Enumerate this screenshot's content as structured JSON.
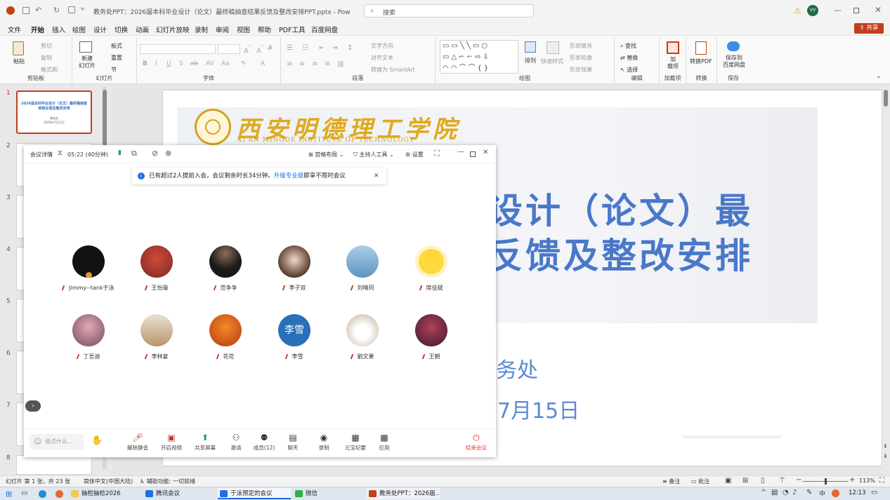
{
  "window": {
    "title": "教务处PPT：2026届本科毕业设计（论文）最终稿抽查结果反馈及整改安排PPT.pptx  -  PowerPoint",
    "search_placeholder": "搜索",
    "user_initials": "YY",
    "share_label": "共享"
  },
  "menu": [
    "文件",
    "开始",
    "插入",
    "绘图",
    "设计",
    "切换",
    "动画",
    "幻灯片放映",
    "录制",
    "审阅",
    "视图",
    "帮助",
    "PDF工具",
    "百度网盘"
  ],
  "ribbon": {
    "clipboard": {
      "paste": "粘贴",
      "cut": "剪切",
      "copy": "复制",
      "format_painter": "格式刷",
      "label": "剪贴板"
    },
    "slides": {
      "new_slide": "新建\n幻灯片",
      "layout": "板式",
      "reset": "重置",
      "section": "节",
      "label": "幻灯片"
    },
    "font": {
      "label": "字体"
    },
    "paragraph": {
      "text_direction": "文字方向",
      "align_text": "对齐文本",
      "convert_smartart": "转换为 SmartArt",
      "label": "段落"
    },
    "drawing": {
      "arrange": "排列",
      "quick_styles": "快速样式",
      "shape_fill": "形状填充",
      "shape_outline": "形状轮廓",
      "shape_effects": "形状效果",
      "label": "绘图"
    },
    "editing": {
      "find": "查找",
      "replace": "替换",
      "select": "选择",
      "label": "编辑"
    },
    "addins": {
      "add": "加\n载项",
      "label": "加载项"
    },
    "convert": {
      "to_pdf": "转换PDF",
      "label": "转换"
    },
    "save": {
      "save_baidu": "保存到\n百度网盘",
      "label": "保存"
    }
  },
  "thumbnails": {
    "numbers": [
      "1",
      "2",
      "3",
      "4",
      "5",
      "6",
      "7",
      "8"
    ],
    "slide1_title": "2026届本科毕业设计（论文）最终稿抽查结果反馈及整改安排",
    "slide1_sub": "教务处",
    "slide1_date": "2026年7月15日"
  },
  "slide": {
    "logo_cn": "西安明德理工学院",
    "logo_en": "XI'AN MINGDE INSTITUTE OF TECHNOLOGY",
    "title_line1": "设计（论文）最",
    "title_line2": "反馈及整改安排",
    "dept": "务处",
    "date": "7月15日"
  },
  "meeting": {
    "details": "会议详情",
    "timer": "05:22 (40分钟)",
    "layout": "宫格布局",
    "host_tools": "主持人工具",
    "settings": "设置",
    "notice": "已有超过2人提前入会，会议剩余时长34分钟。",
    "notice_link": "升级专业版",
    "notice_tail": "即享不限时会议",
    "participants": [
      {
        "name": "Jimmy--tank于泳",
        "color": "#111111",
        "ring": "#d9a03a"
      },
      {
        "name": "王怡璇",
        "color": "#c0392b"
      },
      {
        "name": "范争争",
        "color": "#1d1d1d"
      },
      {
        "name": "李子双",
        "color": "#e3c9b6"
      },
      {
        "name": "刘晴珂",
        "color": "#8fb8d8"
      },
      {
        "name": "席佳斌",
        "color": "#f5c518"
      },
      {
        "name": "丁吾迪",
        "color": "#9b6b7a"
      },
      {
        "name": "李林宴",
        "color": "#b59a76"
      },
      {
        "name": "花花",
        "color": "#e06a1e"
      },
      {
        "name": "李雪",
        "color": "#2a6fb8",
        "text": "李雪"
      },
      {
        "name": "劉文果",
        "color": "#efeae2"
      },
      {
        "name": "王朝",
        "color": "#7a3b52"
      }
    ],
    "chat_placeholder": "说点什么...",
    "toolbar": [
      "解除静音",
      "开启视频",
      "共享屏幕",
      "邀请",
      "成员(12)",
      "聊天",
      "录制",
      "元宝纪要",
      "应用"
    ],
    "end_meeting": "结束会议"
  },
  "status": {
    "slide_count": "幻灯片 第 1 张，共 23 张",
    "language": "简体中文(中国大陆)",
    "accessibility": "辅助功能: 一切就绪",
    "notes": "备注",
    "comments": "批注",
    "zoom": "113%"
  },
  "taskbar": {
    "apps": [
      "抽检抽检2026",
      "腾讯会议",
      "于泳预定的会议",
      "微信",
      "教务处PPT：2026届..."
    ],
    "time": "12:13"
  }
}
